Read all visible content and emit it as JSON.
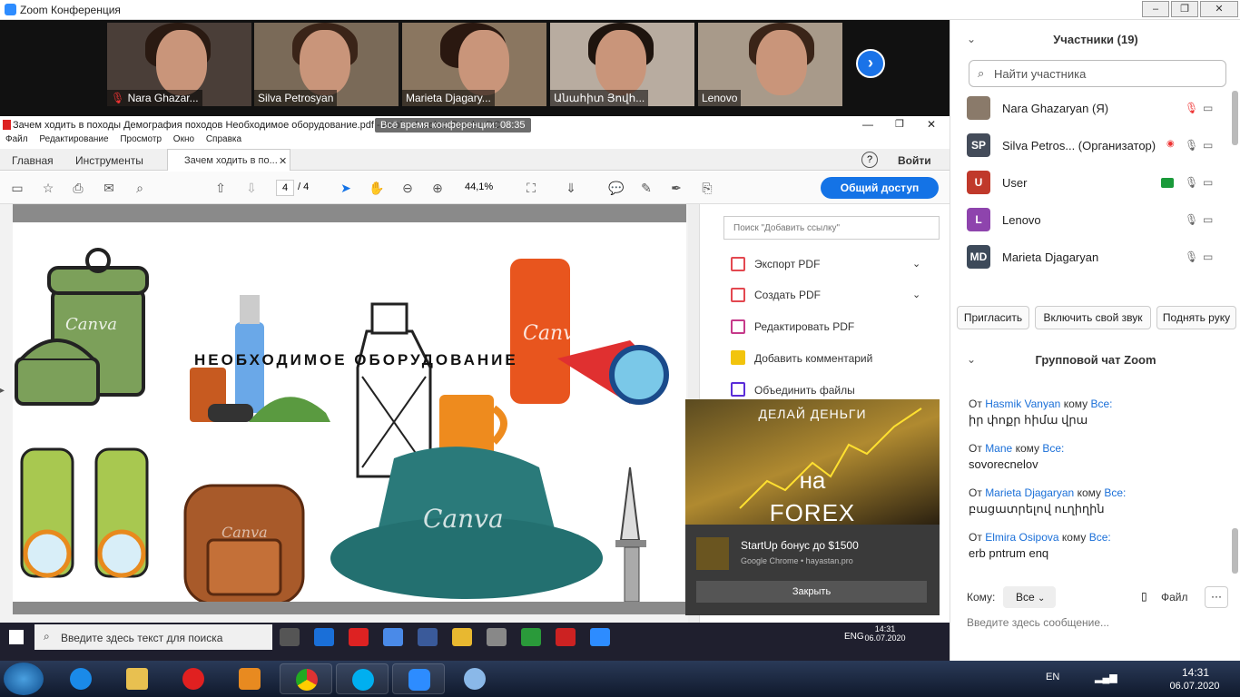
{
  "zoom": {
    "window_title": "Zoom Конференция",
    "participants_video": [
      {
        "name": "Nara Ghazar...",
        "muted": true
      },
      {
        "name": "Silva Petrosyan",
        "muted": false
      },
      {
        "name": "Marieta Djagary...",
        "muted": false
      },
      {
        "name": "Անահիտ Յովհ...",
        "muted": false
      },
      {
        "name": "Lenovo",
        "muted": false
      }
    ],
    "meeting_time_label": "Всё время конференции: 08:35",
    "panel": {
      "participants_title": "Участники (19)",
      "search_placeholder": "Найти участника",
      "participants": [
        {
          "initials": "",
          "name": "Nara Ghazaryan (Я)",
          "color": "#8a7a6a"
        },
        {
          "initials": "SP",
          "name": "Silva Petros...  (Организатор)",
          "color": "#444c5a"
        },
        {
          "initials": "U",
          "name": "User",
          "color": "#c0392b"
        },
        {
          "initials": "L",
          "name": "Lenovo",
          "color": "#8e44ad"
        },
        {
          "initials": "MD",
          "name": "Marieta Djagaryan",
          "color": "#3d4a5a"
        }
      ],
      "buttons": {
        "invite": "Пригласить",
        "unmute": "Включить свой звук",
        "raise_hand": "Поднять руку"
      },
      "chat_title": "Групповой чат Zoom",
      "chat_messages": [
        {
          "from_word": "От",
          "sender": "Hasmik Vanyan",
          "to_word": "кому",
          "to": "Все:",
          "text": "իր փոքր հիմա վրա"
        },
        {
          "from_word": "От",
          "sender": "Mane",
          "to_word": "кому",
          "to": "Все:",
          "text": "sovorecnelov"
        },
        {
          "from_word": "От",
          "sender": "Marieta Djagaryan",
          "to_word": "кому",
          "to": "Все:",
          "text": "բացատրելով ուղիղին"
        },
        {
          "from_word": "От",
          "sender": "Elmira Osipova",
          "to_word": "кому",
          "to": "Все:",
          "text": "erb pntrum enq"
        }
      ],
      "chat_to_label": "Кому:",
      "chat_to_value": "Все",
      "chat_file": "Файл",
      "chat_more": "···",
      "chat_input_placeholder": "Введите здесь сообщение..."
    }
  },
  "acrobat": {
    "window_title": "Зачем ходить в походы Демография походов Необходимое оборудование.pdf - Adobe Acrobat Reader DC",
    "menu": [
      "Файл",
      "Редактирование",
      "Просмотр",
      "Окно",
      "Справка"
    ],
    "tabs": {
      "home": "Главная",
      "tools": "Инструменты",
      "doc": "Зачем ходить в по..."
    },
    "help": "?",
    "signin": "Войти",
    "page_current": "4",
    "page_total": "/ 4",
    "zoom": "44,1%",
    "share_button": "Общий доступ",
    "doc_heading": "НЕОБХОДИМОЕ ОБОРУДОВАНИЕ",
    "watermark": "Canva",
    "right_pane": {
      "search_placeholder": "Поиск \"Добавить ссылку\"",
      "items": [
        {
          "label": "Экспорт PDF",
          "icon": "export-pdf-icon",
          "color": "#e34850"
        },
        {
          "label": "Создать PDF",
          "icon": "create-pdf-icon",
          "color": "#e34850"
        },
        {
          "label": "Редактировать PDF",
          "icon": "edit-pdf-icon",
          "color": "#c63a8a"
        },
        {
          "label": "Добавить комментарий",
          "icon": "comment-icon",
          "color": "#f2c40c"
        },
        {
          "label": "Объединить файлы",
          "icon": "combine-icon",
          "color": "#5a2dd8"
        }
      ]
    }
  },
  "ad": {
    "headline1": "ДЕЛАЙ ДЕНЬГИ",
    "headline2": "на",
    "headline3": "FOREX",
    "title": "StartUp бонус до $1500",
    "source": "Google Chrome • hayastan.pro",
    "close": "Закрыть"
  },
  "inner_taskbar": {
    "search_placeholder": "Введите здесь текст для поиска",
    "lang": "ENG",
    "time": "14:31",
    "date": "06.07.2020"
  },
  "outer_taskbar": {
    "lang": "EN",
    "time": "14:31",
    "date": "06.07.2020"
  }
}
